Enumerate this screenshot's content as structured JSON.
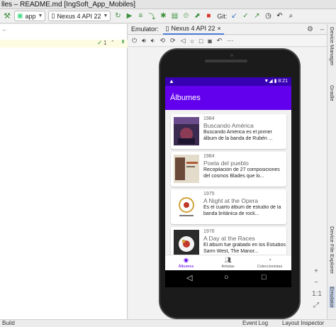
{
  "window": {
    "title": "lles – README.md [IngSoft_App_Mobiles]"
  },
  "toolbar": {
    "run_config": "app",
    "device": "Nexus 4 API 22",
    "git_label": "Git:"
  },
  "editor": {
    "inspection_count": "1"
  },
  "emulator": {
    "panel_label": "Emulator:",
    "tab_label": "Nexus 4 API 22"
  },
  "right_tools": [
    "Device Manager",
    "Gradle",
    "Device File Explorer",
    "Emulator"
  ],
  "status_bar": {
    "left": "Build",
    "event_log": "Event Log",
    "layout_inspector": "Layout Inspector"
  },
  "phone": {
    "time": "8:21",
    "app_title": "Álbumes",
    "albums": [
      {
        "year": "1984",
        "title": "Buscando América",
        "description": "Buscando América es el primer álbum de la banda de Rubén ...",
        "cover_color": "#3b2a4f"
      },
      {
        "year": "1984",
        "title": "Poeta del pueblo",
        "description": "Recopilación de 27 composiciones del cosmos Blades que lo...",
        "cover_color": "#d8cdb7"
      },
      {
        "year": "1975",
        "title": "A Night at the Opera",
        "description": "Es el cuarto álbum de estudio de la banda británica de rock...",
        "cover_color": "#ffffff"
      },
      {
        "year": "1976",
        "title": "A Day at the Races",
        "description": "El álbum fue grabado en los Estudios Sarm West, The Manor...",
        "cover_color": "#2b2b2b"
      }
    ],
    "bottom_nav": [
      {
        "label": "Álbumes",
        "icon": "album-icon",
        "active": true
      },
      {
        "label": "Artistas",
        "icon": "people-icon",
        "active": false
      },
      {
        "label": "Coleccionistas",
        "icon": "collector-icon",
        "active": false
      }
    ]
  },
  "colors": {
    "primary": "#6200ee",
    "primary_dark": "#3700b3"
  }
}
